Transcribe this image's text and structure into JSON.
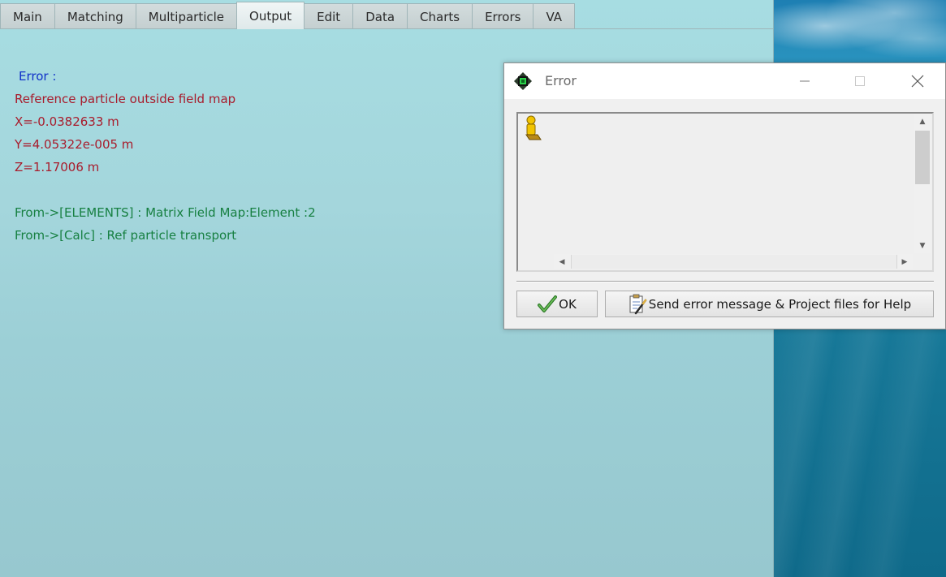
{
  "tabs": [
    {
      "label": "Main"
    },
    {
      "label": "Matching"
    },
    {
      "label": "Multiparticle"
    },
    {
      "label": "Output",
      "active": true
    },
    {
      "label": "Edit"
    },
    {
      "label": "Data"
    },
    {
      "label": "Charts"
    },
    {
      "label": "Errors"
    },
    {
      "label": "VA"
    }
  ],
  "output": {
    "error_heading": "Error :",
    "message": "Reference particle outside field map",
    "x": "X=-0.0382633 m",
    "y": "Y=4.05322e-005 m",
    "z": "Z=1.17006 m",
    "trace_1": "From->[ELEMENTS] : Matrix Field Map:Element :2",
    "trace_2": "From->[Calc] : Ref particle transport",
    "colors": {
      "heading": "#1030c8",
      "error": "#a81c2c",
      "trace": "#178042"
    }
  },
  "dialog": {
    "title": "Error",
    "ok_label": "OK",
    "send_label": "Send error message & Project files for Help",
    "icons": {
      "app": "app-chip-icon",
      "message": "warning-figure-icon",
      "ok": "checkmark-icon",
      "send": "clipboard-pen-icon"
    }
  }
}
